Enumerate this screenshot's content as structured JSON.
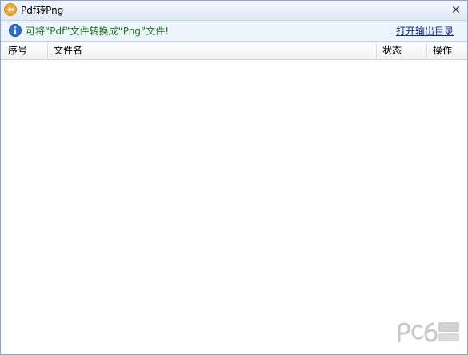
{
  "window": {
    "title": "Pdf转Png",
    "close_glyph": "✕"
  },
  "infobar": {
    "icon": "info-icon",
    "message": "可将“Pdf”文件转换成“Png”文件!",
    "open_output_dir_label": "打开输出目录"
  },
  "table": {
    "columns": [
      "序号",
      "文件名",
      "状态",
      "操作"
    ],
    "rows": []
  },
  "colors": {
    "info_text": "#1b7a1b",
    "link": "#0b2f8c",
    "titlebar": "#dfe9f7",
    "infobar": "#eef4fb"
  }
}
